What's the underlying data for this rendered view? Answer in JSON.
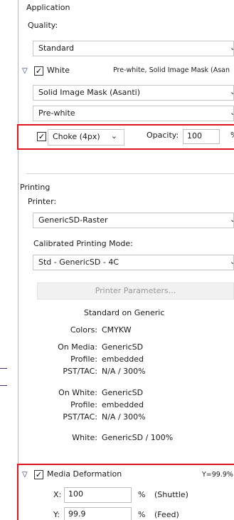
{
  "application": {
    "section_label": "Application",
    "quality_label": "Quality:",
    "quality_value": "Standard",
    "white": {
      "label": "White",
      "checked": true,
      "summary": "Pre-white, Solid Image Mask (Asan",
      "mask_value": "Solid Image Mask (Asanti)",
      "order_value": "Pre-white",
      "choke_checked": true,
      "choke_value": "Choke (4px)",
      "opacity_label": "Opacity:",
      "opacity_value": "100",
      "opacity_unit": "%"
    }
  },
  "printing": {
    "section_label": "Printing",
    "printer_label": "Printer:",
    "printer_value": "GenericSD-Raster",
    "mode_label": "Calibrated Printing Mode:",
    "mode_value": "Std - GenericSD - 4C",
    "params_button": "Printer Parameters...",
    "info": {
      "heading": "Standard on Generic",
      "colors_label": "Colors:",
      "colors_value": "CMYKW",
      "on_media_label": "On Media:",
      "on_media_value": "GenericSD",
      "profile1_label": "Profile:",
      "profile1_value": "embedded",
      "pst1_label": "PST/TAC:",
      "pst1_value": "N/A /  300%",
      "on_white_label": "On White:",
      "on_white_value": "GenericSD",
      "profile2_label": "Profile:",
      "profile2_value": "embedded",
      "pst2_label": "PST/TAC:",
      "pst2_value": "N/A /  300%",
      "white_label": "White:",
      "white_value": "GenericSD / 100%"
    }
  },
  "media_deformation": {
    "label": "Media Deformation",
    "checked": true,
    "summary": "Y=99.9%",
    "x_label": "X:",
    "x_value": "100",
    "x_unit": "%",
    "x_note": "(Shuttle)",
    "y_label": "Y:",
    "y_value": "99.9",
    "y_unit": "%",
    "y_note": "(Feed)"
  },
  "colors": {
    "highlight": "#e0141e",
    "triangle": "#1e2a7a"
  }
}
